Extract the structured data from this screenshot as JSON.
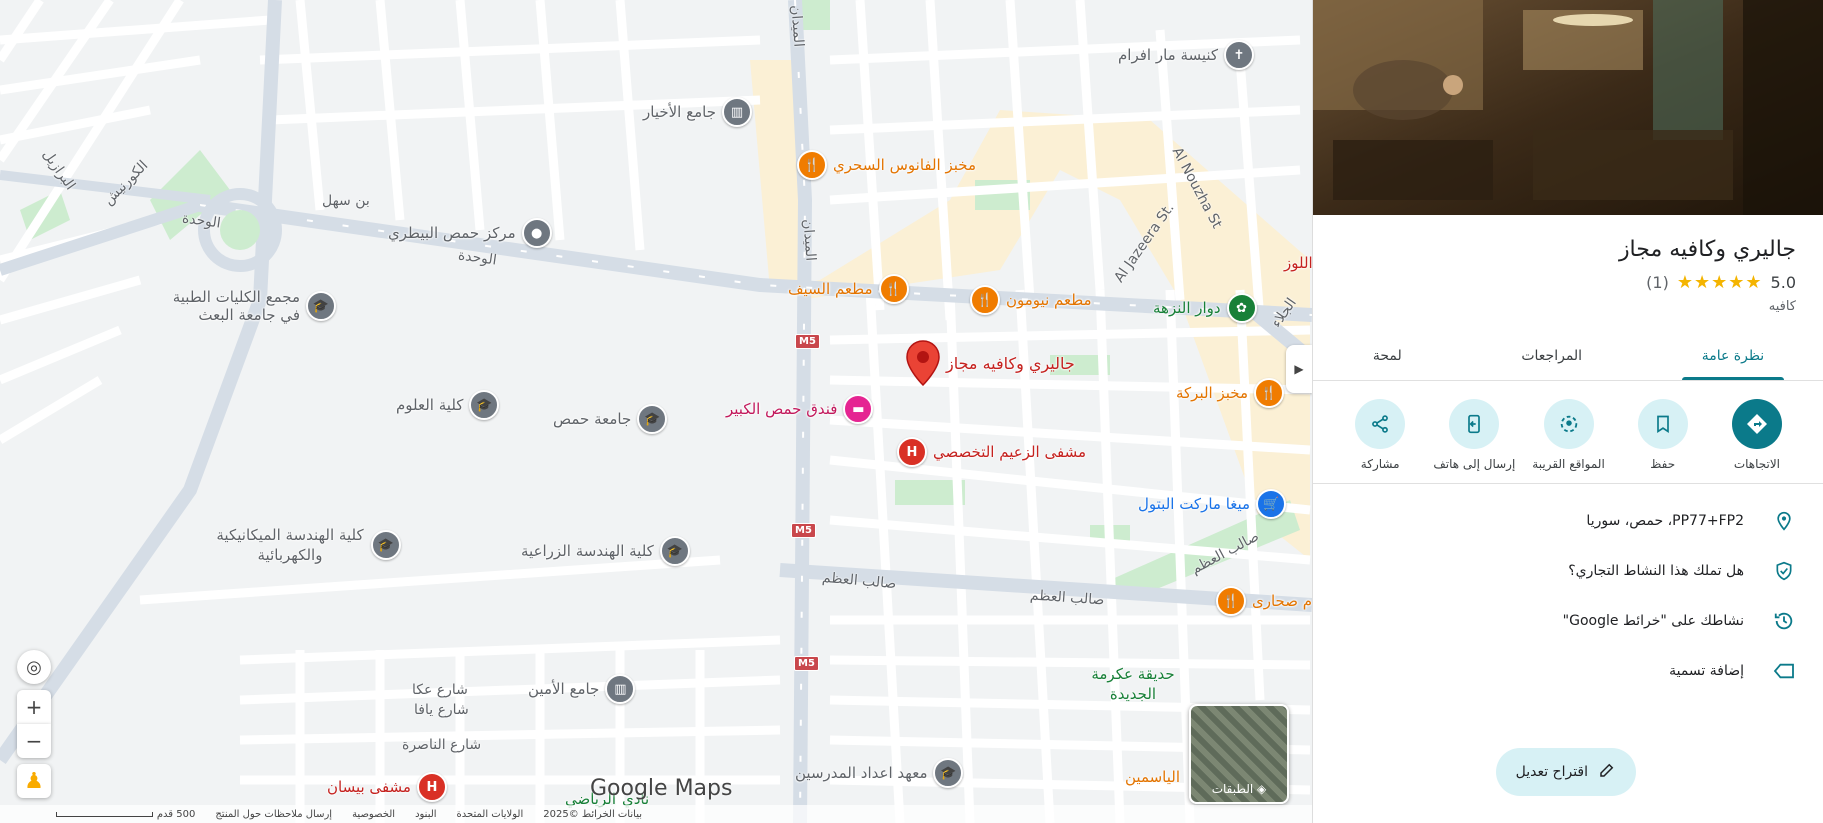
{
  "map": {
    "pois": [
      {
        "id": "place-marker",
        "name": "جاليري وكافيه مجاز",
        "color": "#d93025",
        "type": "selected-pin"
      },
      {
        "id": "mar-afram",
        "name": "كنيسة مار افرام",
        "color": "#5f6368",
        "type": "church-icon"
      },
      {
        "id": "akhyar",
        "name": "جامع الأخيار",
        "color": "#5f6368",
        "type": "mosque-icon"
      },
      {
        "id": "fanous",
        "name": "مخبز الفانوس السحري",
        "color": "#e37400",
        "type": "food-icon"
      },
      {
        "id": "bitari",
        "name": "مركز حمص البيطري",
        "color": "#5f6368",
        "type": "place-icon"
      },
      {
        "id": "medical",
        "name": "مجمع الكليات الطبية في جامعة البعث",
        "color": "#5f6368",
        "type": "school-icon"
      },
      {
        "id": "saif",
        "name": "مطعم السيف",
        "color": "#e37400",
        "type": "food-icon"
      },
      {
        "id": "neumon",
        "name": "مطعم نيومون",
        "color": "#e37400",
        "type": "food-icon"
      },
      {
        "id": "nuzha",
        "name": "دوار النزهة",
        "color": "#188038",
        "type": "park-icon"
      },
      {
        "id": "barakeh",
        "name": "مخبز البركة",
        "color": "#e37400",
        "type": "food-icon"
      },
      {
        "id": "oloum",
        "name": "كلية العلوم",
        "color": "#5f6368",
        "type": "school-icon"
      },
      {
        "id": "jamea",
        "name": "جامعة حمص",
        "color": "#5f6368",
        "type": "school-icon"
      },
      {
        "id": "hotel",
        "name": "فندق حمص الكبير",
        "color": "#c5221f",
        "type": "hotel-icon"
      },
      {
        "id": "hospital1",
        "name": "مشفى الزعيم التخصصي",
        "color": "#c5221f",
        "type": "hospital-icon"
      },
      {
        "id": "batoul",
        "name": "ميغا ماركت البتول",
        "color": "#1a73e8",
        "type": "shop-icon"
      },
      {
        "id": "mech",
        "name": "كلية الهندسة الميكانيكية والكهربائية",
        "color": "#5f6368",
        "type": "school-icon"
      },
      {
        "id": "agri",
        "name": "كلية الهندسة الزراعية",
        "color": "#5f6368",
        "type": "school-icon"
      },
      {
        "id": "sahari",
        "name": "م صحارى",
        "color": "#e37400",
        "type": "food-icon"
      },
      {
        "id": "amin",
        "name": "جامع الأمين",
        "color": "#5f6368",
        "type": "mosque-icon"
      },
      {
        "id": "ikrima",
        "name": "حديقة عكرمة الجديدة",
        "color": "#188038",
        "type": "park-text"
      },
      {
        "id": "teachers",
        "name": "معهد اعداد المدرسين",
        "color": "#5f6368",
        "type": "school-icon"
      },
      {
        "id": "bisan",
        "name": "مشفى بيسان",
        "color": "#c5221f",
        "type": "hospital-icon"
      },
      {
        "id": "yasmin",
        "name": "الياسمين",
        "color": "#e37400",
        "type": "food-text"
      },
      {
        "id": "lawz",
        "name": "اللوز",
        "color": "#c5221f",
        "type": "text"
      },
      {
        "id": "nadi",
        "name": "نادي",
        "color": "#188038",
        "type": "text"
      },
      {
        "id": "riyadi",
        "name": "الرياضي",
        "color": "#188038",
        "type": "text"
      }
    ],
    "roads": {
      "maydan1": "الميدان",
      "maydan2": "الميدان",
      "wahda1": "الوحدة",
      "wahda2": "الوحدة",
      "ibnsahl": "بن سهل",
      "corniche": "الكورنيش",
      "barazil": "البرازيل",
      "jazeera": "Al Jazeera St.",
      "nouzha": "Al Nouzha St",
      "jalaa": "الجلاء",
      "saleh1": "صالب العظم",
      "saleh2": "صالب العظم",
      "saleh3": "صالب العظم",
      "akka": "شارع عكا",
      "yafa": "شارع يافا",
      "nasira": "شارع الناصرة"
    },
    "route_shield": "M5",
    "layers_label": "الطبقات",
    "logo": "Google Maps",
    "attribution": {
      "data": "بيانات الخرائط ©2025",
      "us": "الولايات المتحدة",
      "terms": "البنود",
      "privacy": "الخصوصية",
      "feedback": "إرسال ملاحظات حول المنتج",
      "scale": "500 قدم"
    }
  },
  "place": {
    "title": "جاليري وكافيه مجاز",
    "rating": "5.0",
    "stars": "★★★★★",
    "reviews_count": "(1)",
    "category": "كافيه",
    "tabs": [
      "نظرة عامة",
      "المراجعات",
      "لمحة"
    ],
    "actions": [
      {
        "label": "الاتجاهات",
        "icon": "directions-icon"
      },
      {
        "label": "حفظ",
        "icon": "bookmark-icon"
      },
      {
        "label": "المواقع القريبة",
        "icon": "nearby-icon"
      },
      {
        "label": "إرسال إلى هاتف",
        "icon": "send-to-phone-icon"
      },
      {
        "label": "مشاركة",
        "icon": "share-icon"
      }
    ],
    "info": [
      {
        "text": "PP77+FP2، حمص، سوريا",
        "icon": "location-pin-icon"
      },
      {
        "text": "هل تملك هذا النشاط التجاري؟",
        "icon": "verified-shield-icon"
      },
      {
        "text": "نشاطك على \"خرائط Google\"",
        "icon": "history-icon"
      },
      {
        "text": "إضافة تسمية",
        "icon": "label-icon"
      }
    ],
    "suggest_edit": "اقتراح تعديل"
  },
  "colors": {
    "accent": "#0b7a8a",
    "accent_light": "#d7f1f5",
    "marker": "#d93025"
  }
}
